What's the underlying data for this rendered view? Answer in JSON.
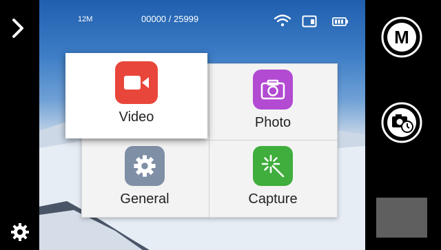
{
  "status": {
    "resolution": "12M",
    "shot_counter": "00000 / 25999",
    "wifi_icon": "wifi-icon",
    "sd_icon": "sd-card-icon",
    "battery_icon": "battery-icon"
  },
  "menu": {
    "items": [
      {
        "label": "Video",
        "icon": "video-camera-icon",
        "color": "#e9463b",
        "selected": true
      },
      {
        "label": "Photo",
        "icon": "photo-camera-icon",
        "color": "#b24ad2"
      },
      {
        "label": "General",
        "icon": "gear-icon",
        "color": "#7f8fa6"
      },
      {
        "label": "Capture",
        "icon": "sparkle-wand-icon",
        "color": "#3fae3c"
      }
    ]
  },
  "right_controls": {
    "mode_button_label": "M",
    "mode_button_icon": "mode-m-icon",
    "self_timer_icon": "camera-timer-icon",
    "preview_thumbnail": "preview-thumbnail"
  },
  "left_controls": {
    "back_icon": "chevron-right-icon",
    "settings_icon": "gear-icon"
  }
}
